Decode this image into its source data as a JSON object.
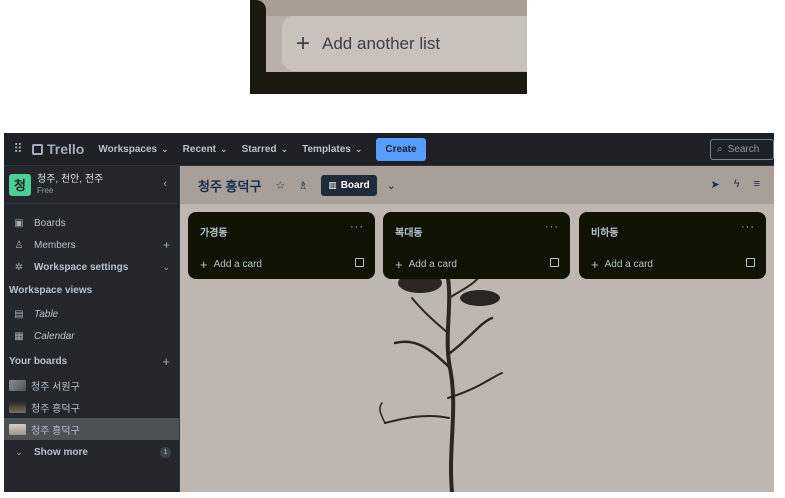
{
  "zoom_inset": {
    "add_list_label": "Add another list",
    "plus": "+"
  },
  "topbar": {
    "app_name": "Trello",
    "menus": [
      "Workspaces",
      "Recent",
      "Starred",
      "Templates"
    ],
    "create_label": "Create",
    "search_placeholder": "Search"
  },
  "sidebar": {
    "workspace": {
      "initial": "청",
      "name": "청주, 천안, 전주",
      "plan": "Free"
    },
    "items": [
      {
        "label": "Boards",
        "icon": "board-icon"
      },
      {
        "label": "Members",
        "icon": "person-icon"
      },
      {
        "label": "Workspace settings",
        "icon": "gear-icon"
      }
    ],
    "views_title": "Workspace views",
    "views": [
      {
        "label": "Table",
        "icon": "table-icon"
      },
      {
        "label": "Calendar",
        "icon": "calendar-icon"
      }
    ],
    "boards_title": "Your boards",
    "boards": [
      {
        "label": "청주 서원구"
      },
      {
        "label": "청주 흥덕구"
      },
      {
        "label": "청주 흥덕구"
      }
    ],
    "show_more": "Show more",
    "show_more_count": "1"
  },
  "board": {
    "title": "청주 흥덕구",
    "view_label": "Board",
    "lists": [
      {
        "title": "가경동",
        "add_card": "Add a card"
      },
      {
        "title": "복대동",
        "add_card": "Add a card"
      },
      {
        "title": "비하동",
        "add_card": "Add a card"
      }
    ],
    "menu_glyph": "···"
  },
  "colors": {
    "accent": "#579dff",
    "list_bg": "#101204",
    "sidebar_bg": "#23272c",
    "workspace_avatar": "#4bce97"
  }
}
